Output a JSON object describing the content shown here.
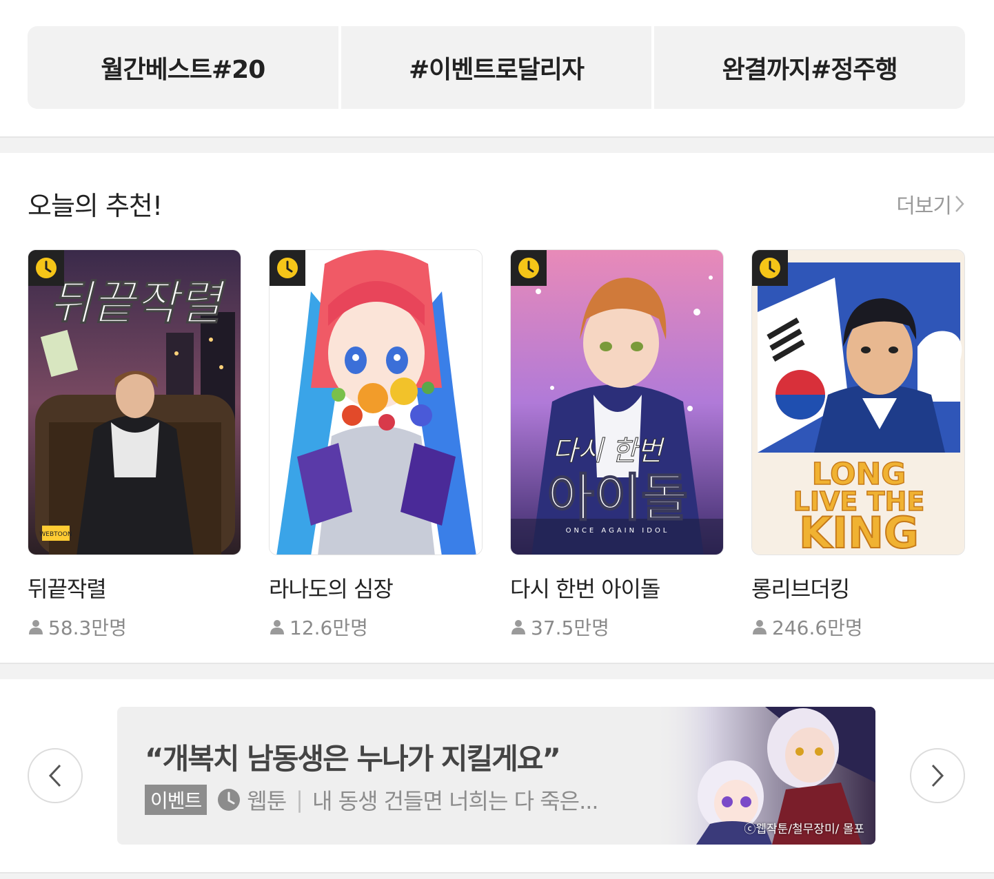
{
  "tags": [
    {
      "label": "월간베스트#20"
    },
    {
      "label": "#이벤트로달리자"
    },
    {
      "label": "완결까지#정주행"
    }
  ],
  "section": {
    "title": "오늘의 추천!",
    "more_label": "더보기"
  },
  "cards": [
    {
      "title": "뒤끝작렬",
      "views": "58.3만명",
      "cover_text": "뒤끝작렬",
      "cover_badge": "WEBTOON"
    },
    {
      "title": "라나도의 심장",
      "views": "12.6만명"
    },
    {
      "title": "다시 한번 아이돌",
      "views": "37.5만명",
      "cover_text_top": "다시 한번",
      "cover_text_main": "아이돌",
      "cover_sub": "ONCE AGAIN IDOL"
    },
    {
      "title": "롱리브더킹",
      "views": "246.6만명",
      "cover_text_1": "LONG",
      "cover_text_2": "LIVE THE",
      "cover_text_3": "KING"
    }
  ],
  "banner": {
    "quote": "“개복치 남동생은 누나가 지킬게요”",
    "badge": "이벤트",
    "type": "웹툰",
    "separator": "|",
    "description": "내 동생 건들면 너희는 다 죽은...",
    "credit": "ⓒ웹작툰/철무장미/ 몰포"
  },
  "colors": {
    "tab_bg": "#f2f2f2",
    "badge_bg": "#222222",
    "clock_yellow": "#f5c518",
    "muted_text": "#8a8a8a"
  },
  "icons": {
    "clock": "clock-icon",
    "person": "person-icon",
    "chevron_left": "chevron-left-icon",
    "chevron_right": "chevron-right-icon"
  }
}
